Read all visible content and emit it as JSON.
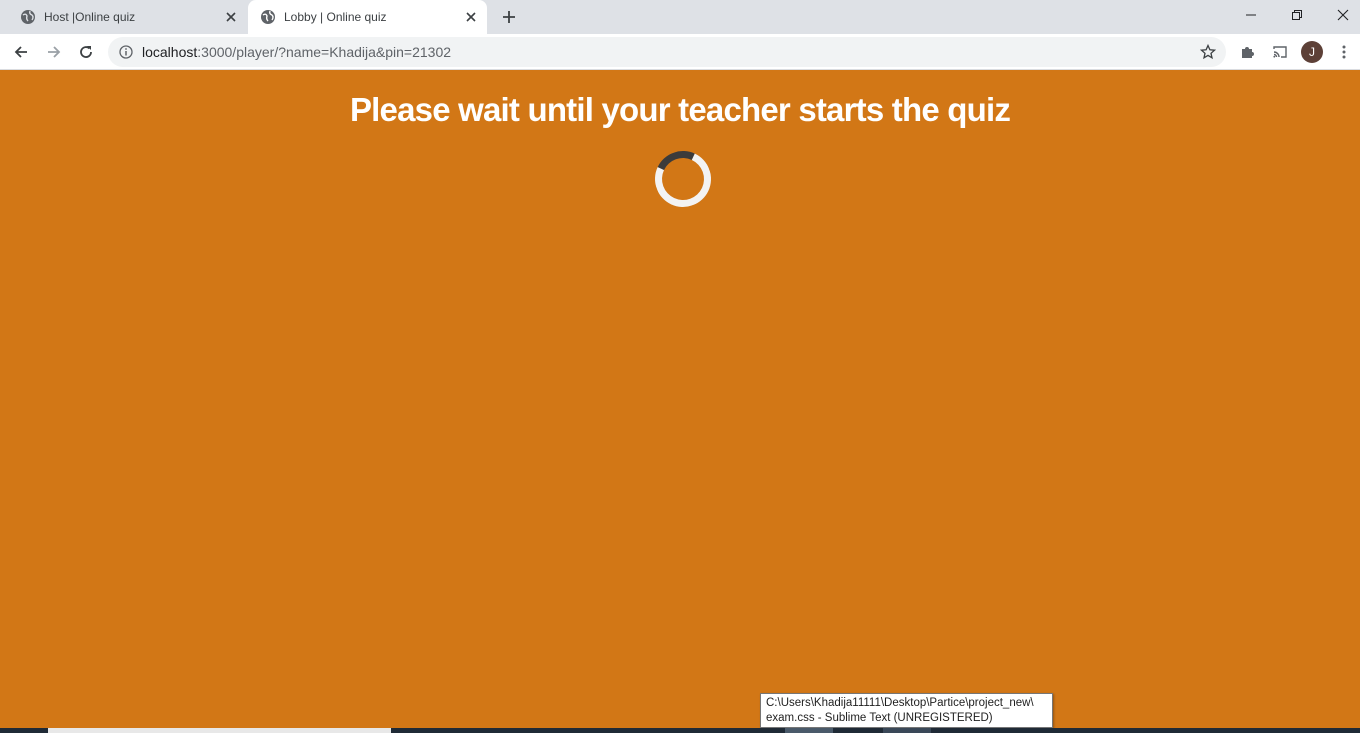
{
  "browser": {
    "tabs": [
      {
        "title": "Host |Online quiz",
        "active": false
      },
      {
        "title": "Lobby | Online quiz",
        "active": true
      }
    ],
    "url_host": "localhost",
    "url_path": ":3000/player/?name=Khadija&pin=21302",
    "profile_initial": "J"
  },
  "page": {
    "background_color": "#d27716",
    "heading": "Please wait until your teacher starts the quiz"
  },
  "taskbar_tooltip": {
    "line1": "C:\\Users\\Khadija11111\\Desktop\\Partice\\project_new\\",
    "line2": "exam.css - Sublime Text (UNREGISTERED)"
  }
}
